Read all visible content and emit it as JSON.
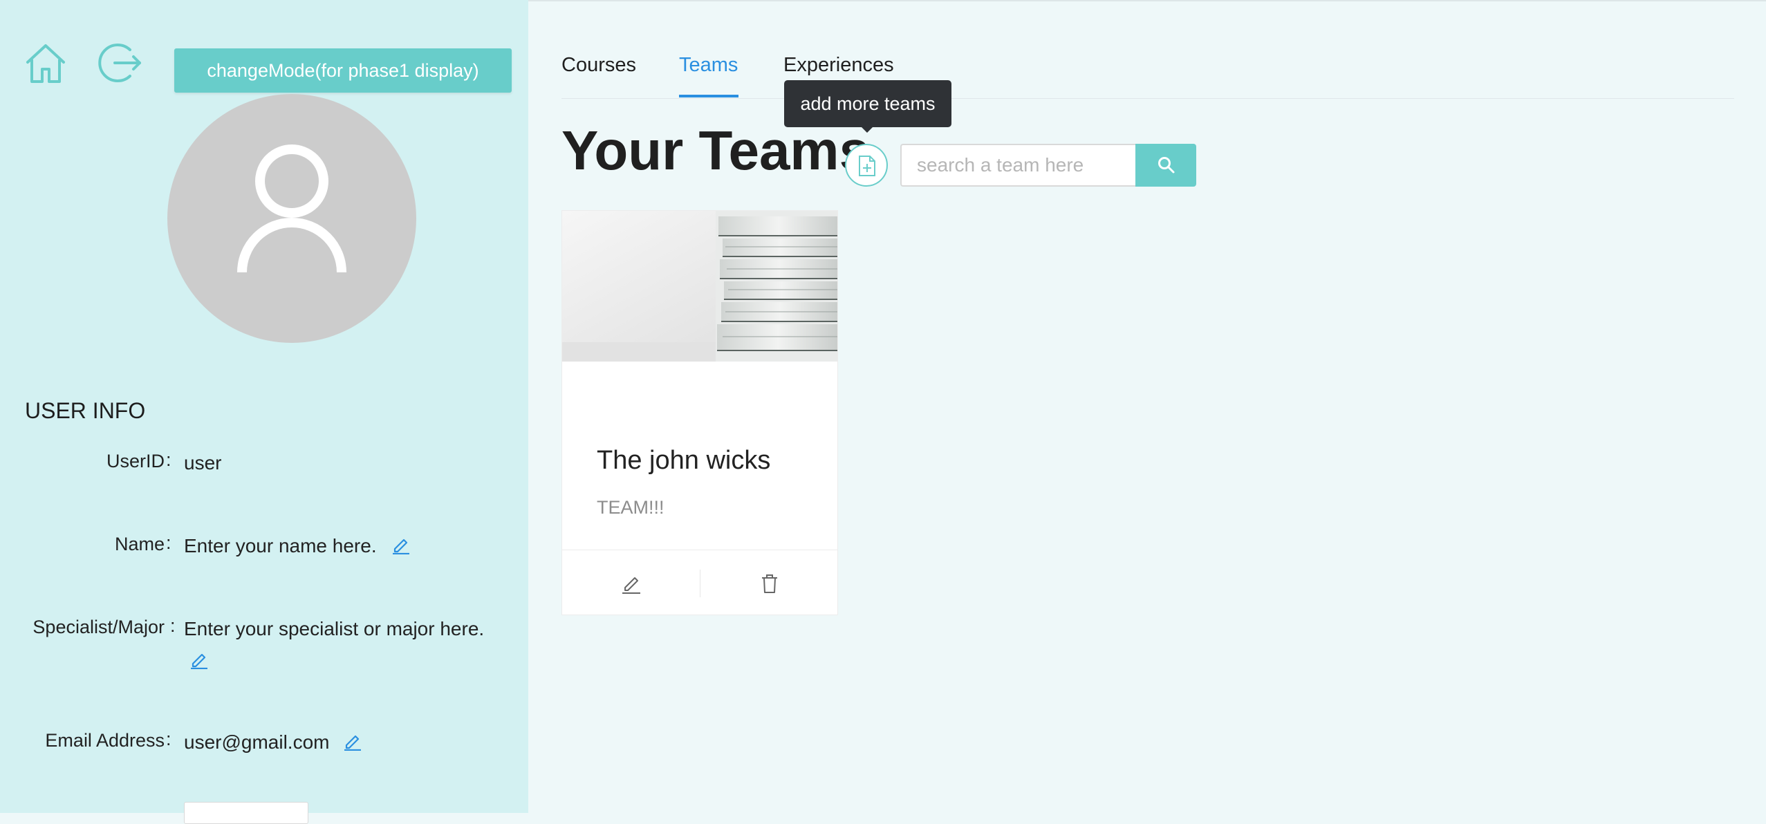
{
  "sidebar": {
    "mode_button_label": "changeMode(for phase1 display)",
    "user_info": {
      "title": "USER INFO",
      "fields": [
        {
          "label": "UserID",
          "value": "user"
        },
        {
          "label": "Name",
          "value": "Enter your name here."
        },
        {
          "label": "Specialist/Major",
          "value": "Enter your specialist or major here."
        },
        {
          "label": "Email Address",
          "value": "user@gmail.com"
        }
      ],
      "colon": ":"
    }
  },
  "tabs": [
    {
      "label": "Courses",
      "active": false
    },
    {
      "label": "Teams",
      "active": true
    },
    {
      "label": "Experiences",
      "active": false
    }
  ],
  "main": {
    "title": "Your Teams",
    "add_tooltip": "add more teams",
    "search_placeholder": "search a team here",
    "teams": [
      {
        "name": "The john wicks",
        "description": "TEAM!!!"
      }
    ]
  },
  "colors": {
    "accent": "#68cdca",
    "active_tab": "#2a8fe0",
    "sidebar_bg": "#d3f1f2",
    "main_bg": "#eef8f9"
  },
  "icons": [
    "home-icon",
    "logout-icon",
    "user-avatar-icon",
    "edit-icon",
    "add-file-icon",
    "search-icon",
    "delete-icon"
  ]
}
